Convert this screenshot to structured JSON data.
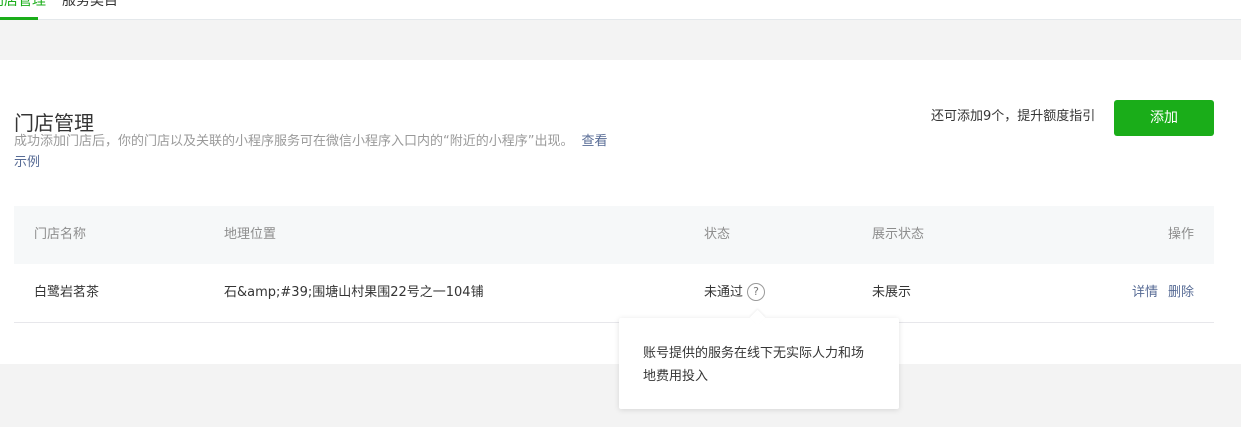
{
  "nav": {
    "tabs": [
      {
        "label": "门店管理",
        "active": true
      },
      {
        "label": "服务类目",
        "active": false
      }
    ]
  },
  "header": {
    "title": "门店管理",
    "description": "成功添加门店后，你的门店以及关联的小程序服务可在微信小程序入口内的“附近的小程序”出现。",
    "example_link": "查看示例",
    "quota_text": "还可添加9个，提升额度指引",
    "add_button": "添加"
  },
  "table": {
    "columns": [
      "门店名称",
      "地理位置",
      "状态",
      "展示状态",
      "操作"
    ],
    "rows": [
      {
        "name": "白鹭岩茗茶",
        "location": "石&amp;#39;围塘山村果围22号之一104铺",
        "status": "未通过",
        "display_status": "未展示",
        "actions": [
          "详情",
          "删除"
        ]
      }
    ]
  },
  "tooltip": {
    "text": "账号提供的服务在线下无实际人力和场地费用投入"
  },
  "colors": {
    "accent": "#1aad19",
    "link": "#576b95"
  }
}
